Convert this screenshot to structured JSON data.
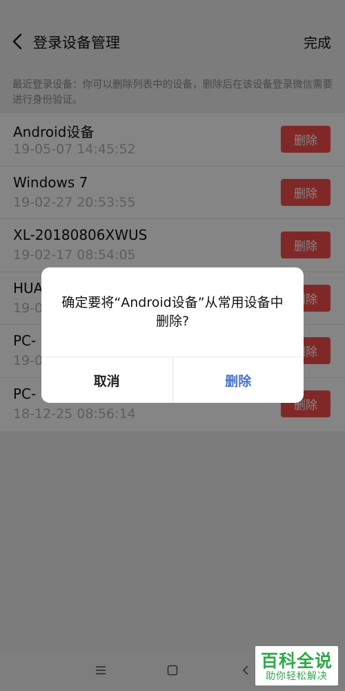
{
  "header": {
    "title": "登录设备管理",
    "done_label": "完成"
  },
  "notice": "最近登录设备：你可以删除列表中的设备，删除后在该设备登录微信需要进行身份验证。",
  "devices": [
    {
      "name": "Android设备",
      "time": "19-05-07 14:45:52",
      "delete_label": "删除"
    },
    {
      "name": "Windows 7",
      "time": "19-02-27 20:53:55",
      "delete_label": "删除"
    },
    {
      "name": "XL-20180806XWUS",
      "time": "19-02-17 08:54:05",
      "delete_label": "删除"
    },
    {
      "name": "HUA",
      "time": "19-0",
      "delete_label": "删除"
    },
    {
      "name": "PC-",
      "time": "19-0",
      "delete_label": "删除"
    },
    {
      "name": "PC-",
      "time": "18-12-25 08:56:14",
      "delete_label": "删除"
    }
  ],
  "dialog": {
    "message": "确定要将“Android设备”从常用设备中删除?",
    "cancel_label": "取消",
    "confirm_label": "删除"
  },
  "navbar": {
    "menu_icon": "menu-icon",
    "home_icon": "home-square-icon",
    "back_icon": "back-chevron-icon"
  },
  "watermark": {
    "main": "百科全说",
    "sub": "助你轻松解决"
  },
  "colors": {
    "delete_red": "#f54e4e",
    "confirm_blue": "#4a73c7",
    "watermark_green": "#2ea84a"
  }
}
